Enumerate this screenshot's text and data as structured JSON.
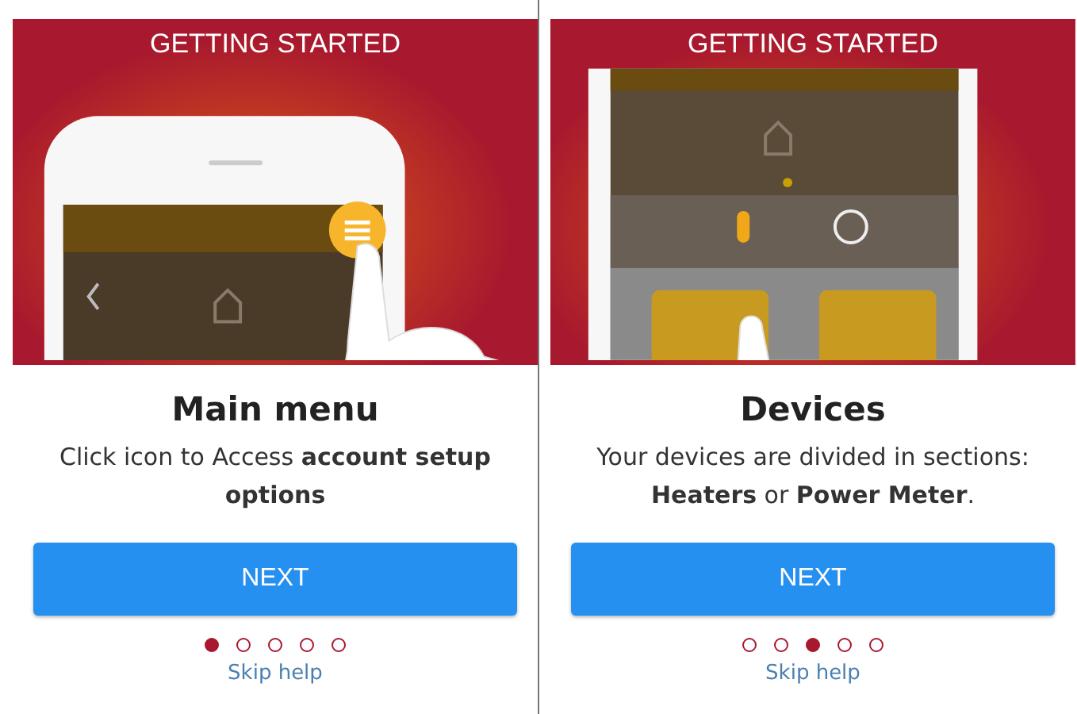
{
  "panels": [
    {
      "header": "GETTING STARTED",
      "kind": "menu",
      "title": "Main menu",
      "description": "Click icon to Access **account setup options**",
      "button": "NEXT",
      "dots": [
        {
          "selected": true
        },
        {
          "selected": false
        },
        {
          "selected": false
        },
        {
          "selected": false
        },
        {
          "selected": false
        }
      ],
      "link": "Skip help"
    },
    {
      "header": "GETTING STARTED",
      "kind": "devices",
      "title": "Devices",
      "description": "Your devices are divided in sections: **Heaters** or **Power Meter**.",
      "button": "NEXT",
      "dots": [
        {
          "selected": false
        },
        {
          "selected": false
        },
        {
          "selected": true
        },
        {
          "selected": false
        },
        {
          "selected": false
        }
      ],
      "link": "Skip help"
    }
  ]
}
